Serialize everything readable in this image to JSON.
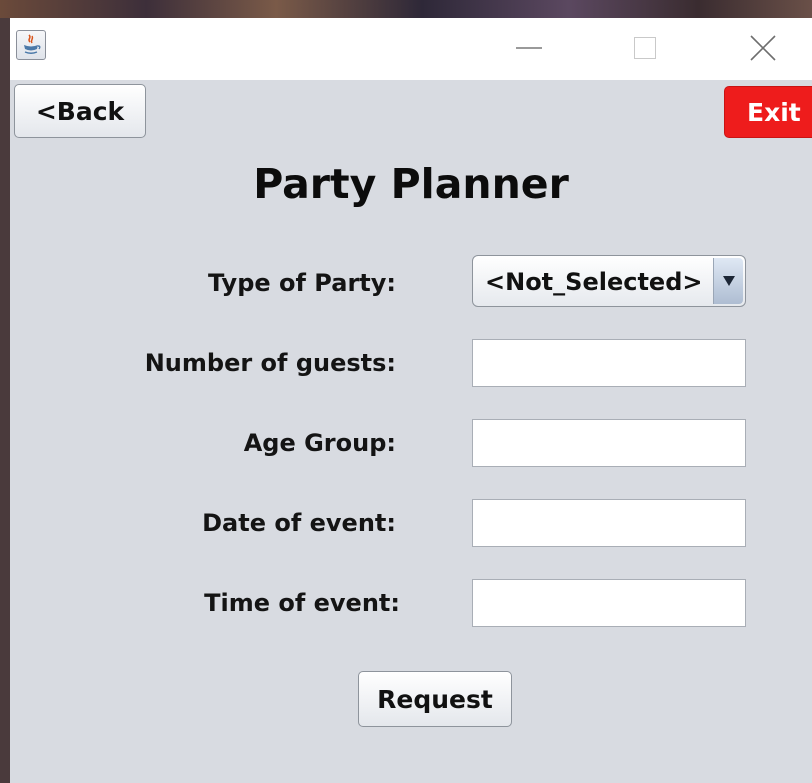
{
  "window": {
    "icon": "java-icon",
    "controls": [
      "minimize-icon",
      "maximize-icon",
      "close-icon"
    ]
  },
  "nav": {
    "back_label": "<Back",
    "exit_label": "Exit",
    "exit_color": "#ee1c1c"
  },
  "form": {
    "title": "Party Planner",
    "type_label": "Type of Party:",
    "type_value": "<Not_Selected>",
    "guests_label": "Number of guests:",
    "guests_value": "",
    "age_label": "Age Group:",
    "age_value": "",
    "date_label": "Date of event:",
    "date_value": "",
    "time_label": "Time of event:",
    "time_value": "",
    "request_label": "Request"
  }
}
